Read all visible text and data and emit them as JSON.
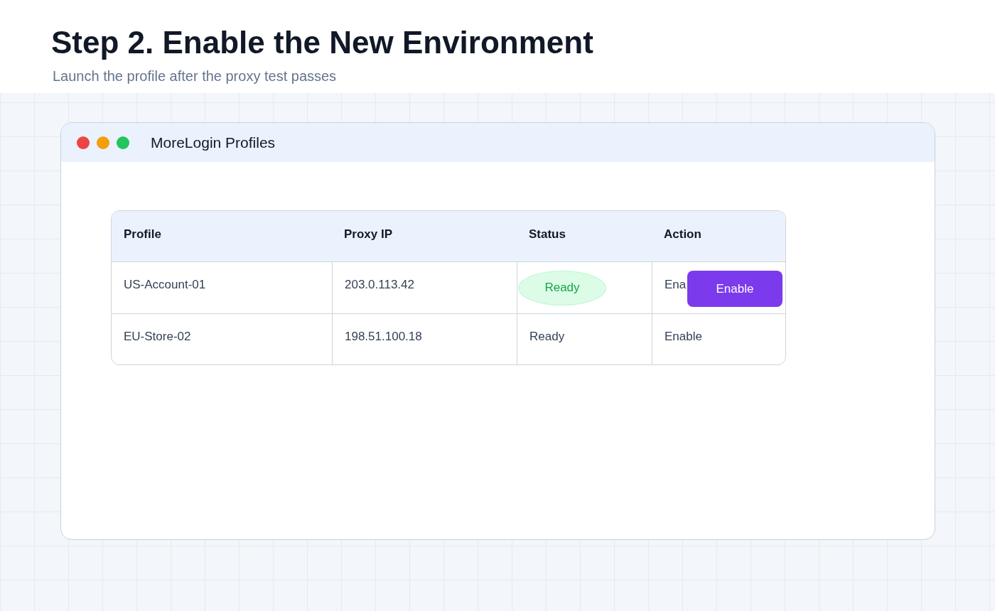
{
  "heading": {
    "title": "Step 2. Enable the New Environment",
    "subtitle": "Launch the profile after the proxy test passes"
  },
  "window": {
    "title": "MoreLogin Profiles",
    "controls": [
      {
        "color": "#ef4444"
      },
      {
        "color": "#f59e0b"
      },
      {
        "color": "#22c55e"
      }
    ]
  },
  "table": {
    "columns": [
      "Profile",
      "Proxy IP",
      "Status",
      "Action"
    ],
    "rows": [
      {
        "profile": "US-Account-01",
        "proxy_ip": "203.0.113.42",
        "status": "Ready",
        "kind": "badge",
        "action": "Ena",
        "action_button": "Enable"
      },
      {
        "profile": "EU-Store-02",
        "proxy_ip": "198.51.100.18",
        "status": "Ready",
        "kind": "plain",
        "action": "Enable"
      }
    ]
  }
}
